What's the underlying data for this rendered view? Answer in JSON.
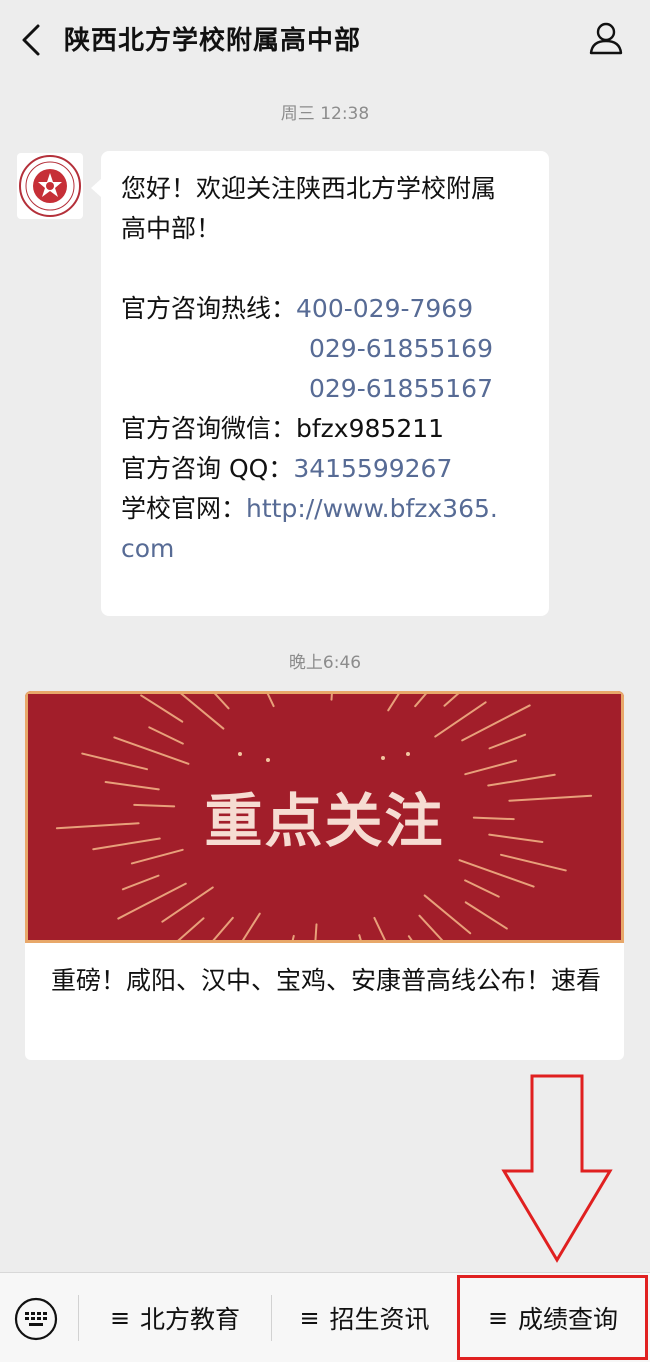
{
  "header": {
    "title": "陕西北方学校附属高中部"
  },
  "messages": {
    "time1": "周三 12:38",
    "welcome": {
      "line1": "您好！欢迎关注陕西北方学校附属",
      "line2": "高中部！",
      "hotline_label": "官方咨询热线：",
      "hotline_1": "400-029-7969",
      "hotline_2": "029-61855169",
      "hotline_3": "029-61855167",
      "wechat_label": "官方咨询微信：",
      "wechat_value": "bfzx985211",
      "qq_label": "官方咨询 QQ：",
      "qq_value": "3415599267",
      "site_label": "学校官网：",
      "site_value_1": "http://www.bfzx365.",
      "site_value_2": "com"
    },
    "time2": "晚上6:46",
    "article": {
      "cover_text": "重点关注",
      "title": "重磅！咸阳、汉中、宝鸡、安康普高线公布！速看"
    }
  },
  "menu": {
    "hamburger": "≡",
    "item1": "北方教育",
    "item2": "招生资讯",
    "item3": "成绩查询"
  },
  "colors": {
    "link": "#576b95",
    "cover_red": "#a21e2a",
    "highlight": "#e02020"
  }
}
